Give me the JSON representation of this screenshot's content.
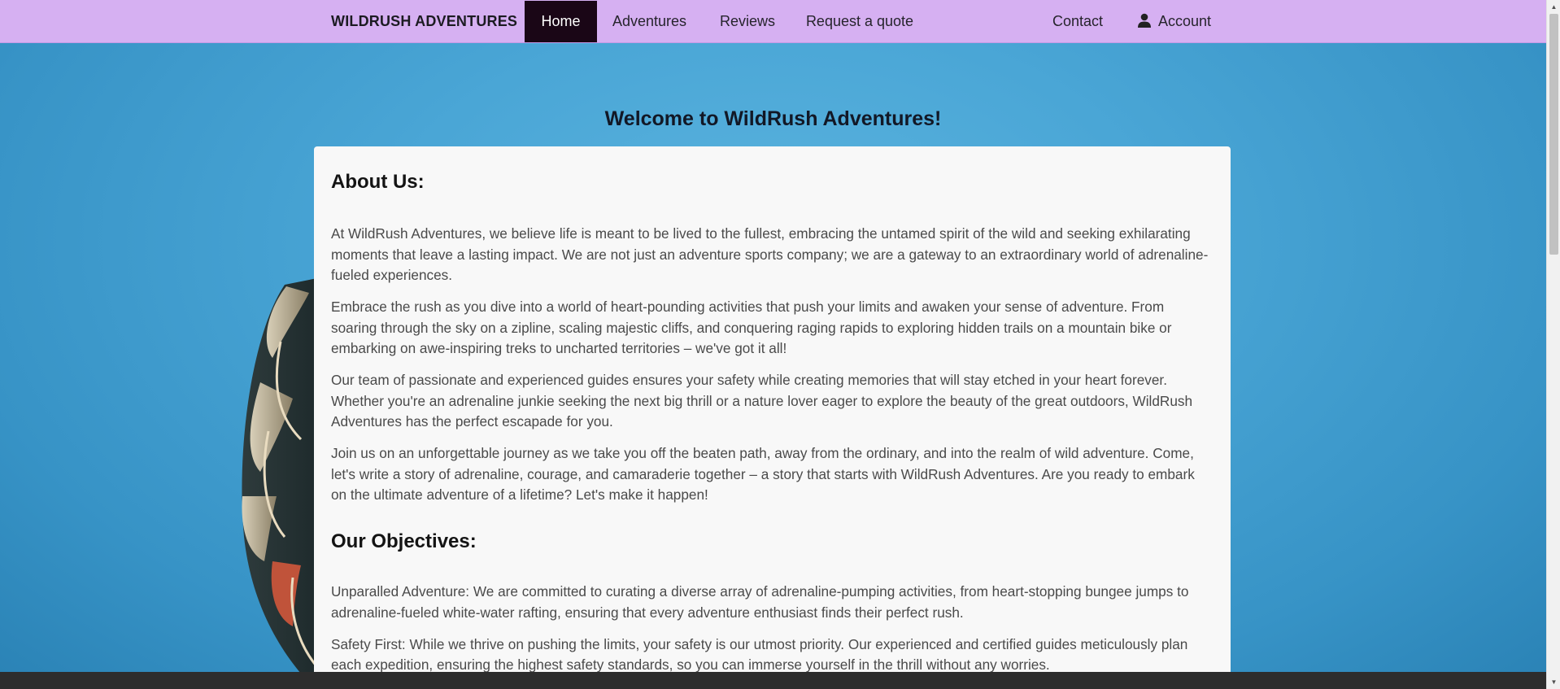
{
  "nav": {
    "brand": "WILDRUSH ADVENTURES",
    "items": [
      {
        "label": "Home",
        "active": true
      },
      {
        "label": "Adventures",
        "active": false
      },
      {
        "label": "Reviews",
        "active": false
      },
      {
        "label": "Request a quote",
        "active": false
      }
    ],
    "contact": "Contact",
    "account": "Account"
  },
  "hero": {
    "welcome": "Welcome to WildRush Adventures!"
  },
  "about": {
    "heading": "About Us:",
    "paragraphs": [
      "At WildRush Adventures, we believe life is meant to be lived to the fullest, embracing the untamed spirit of the wild and seeking exhilarating moments that leave a lasting impact. We are not just an adventure sports company; we are a gateway to an extraordinary world of adrenaline-fueled experiences.",
      "Embrace the rush as you dive into a world of heart-pounding activities that push your limits and awaken your sense of adventure. From soaring through the sky on a zipline, scaling majestic cliffs, and conquering raging rapids to exploring hidden trails on a mountain bike or embarking on awe-inspiring treks to uncharted territories – we've got it all!",
      "Our team of passionate and experienced guides ensures your safety while creating memories that will stay etched in your heart forever. Whether you're an adrenaline junkie seeking the next big thrill or a nature lover eager to explore the beauty of the great outdoors, WildRush Adventures has the perfect escapade for you.",
      "Join us on an unforgettable journey as we take you off the beaten path, away from the ordinary, and into the realm of wild adventure. Come, let's write a story of adrenaline, courage, and camaraderie together – a story that starts with WildRush Adventures. Are you ready to embark on the ultimate adventure of a lifetime? Let's make it happen!"
    ]
  },
  "objectives": {
    "heading": "Our Objectives:",
    "paragraphs": [
      "Unparalled Adventure: We are committed to curating a diverse array of adrenaline-pumping activities, from heart-stopping bungee jumps to adrenaline-fueled white-water rafting, ensuring that every adventure enthusiast finds their perfect rush.",
      "Safety First: While we thrive on pushing the limits, your safety is our utmost priority. Our experienced and certified guides meticulously plan each expedition, ensuring the highest safety standards, so you can immerse yourself in the thrill without any worries."
    ]
  },
  "colors": {
    "navbar": "#d6b0f2",
    "nav_active": "#1a0616",
    "sky": "#4aa6d6",
    "panel": "#f8f8f8"
  },
  "icons": {
    "account": "user-icon"
  }
}
